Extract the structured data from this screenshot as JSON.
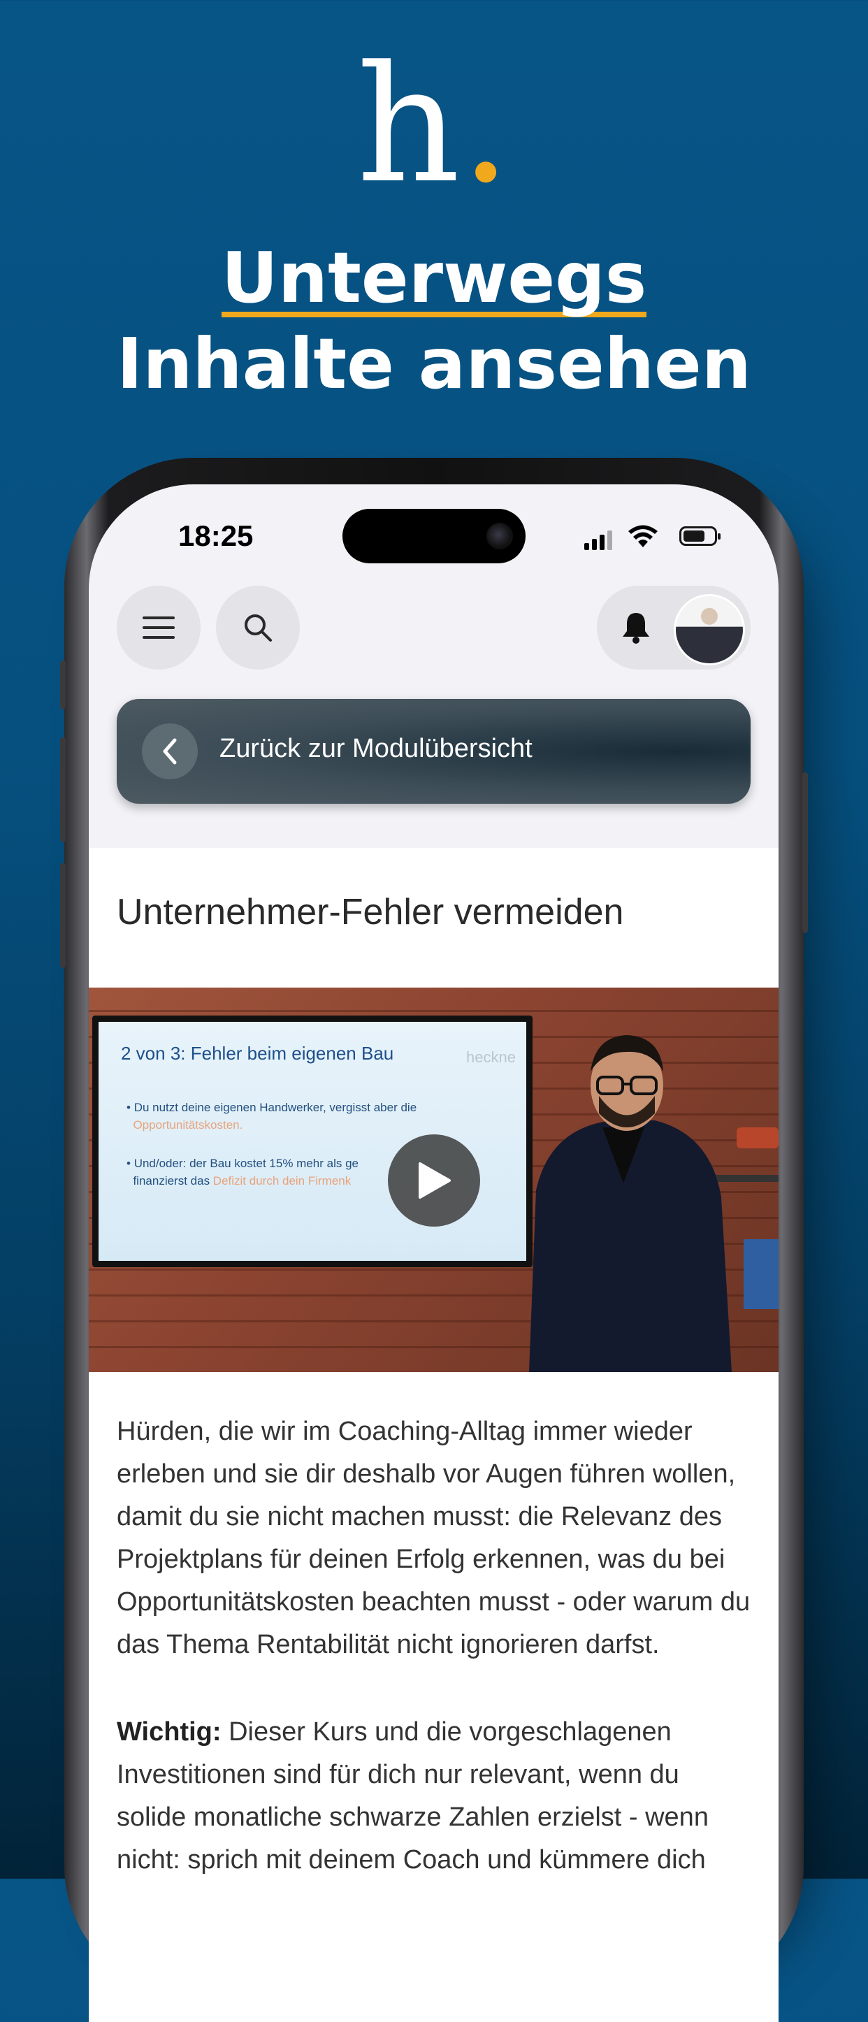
{
  "brand": {
    "logo_letter": "h",
    "logo_dot": ".",
    "accent": "#f0a81c"
  },
  "headline": {
    "line1": "Unterwegs",
    "line2": "Inhalte ansehen"
  },
  "status_bar": {
    "time": "18:25"
  },
  "toolbar": {
    "menu_icon": "hamburger-icon",
    "search_icon": "search-icon",
    "bell_icon": "bell-icon"
  },
  "back_bar": {
    "label": "Zurück zur Modulübersicht"
  },
  "module": {
    "title": "Unternehmer-Fehler vermeiden",
    "video": {
      "slide_title": "2 von 3: Fehler beim eigenen Bau",
      "slide_brand": "heckne",
      "bullet1_text": "Du nutzt deine eigenen Handwerker, vergisst aber die",
      "bullet1_highlight": "Opportunitätskosten.",
      "bullet2_line1": "Und/oder: der Bau kostet 15% mehr als ge",
      "bullet2_line2_text": "finanzierst das ",
      "bullet2_line2_highlight": "Defizit durch dein Firmenk",
      "play_icon": "play-icon"
    },
    "description": "Hürden, die wir im Coaching-Alltag immer wieder erleben und sie dir deshalb vor Augen führen wollen, damit du sie nicht machen musst: die Relevanz des Projektplans für deinen Erfolg erkennen, was du bei Opportunitätskosten beachten musst - oder warum du das Thema Rentabilität nicht ignorieren darfst.",
    "important_label": "Wichtig:",
    "important_text": " Dieser Kurs und die vorgeschlagenen Investitionen sind für dich nur relevant, wenn du solide monatliche schwarze Zahlen erzielst - wenn nicht: sprich mit deinem Coach und kümmere dich"
  }
}
